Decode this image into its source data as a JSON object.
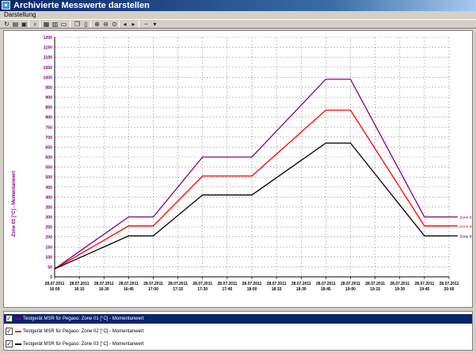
{
  "window": {
    "title": "Archivierte Messwerte darstellen",
    "icon": "app-chart-icon"
  },
  "menu": {
    "items": [
      "Darstellung"
    ]
  },
  "toolbar": {
    "buttons": [
      {
        "name": "refresh-icon",
        "glyph": "↻"
      },
      {
        "name": "print-icon",
        "glyph": "▤"
      },
      {
        "name": "save-icon",
        "glyph": "▣"
      },
      {
        "name": "find-icon",
        "glyph": "⌕"
      },
      {
        "name": "table-icon",
        "glyph": "▦"
      },
      {
        "name": "grid-icon",
        "glyph": "▥"
      },
      {
        "name": "export-icon",
        "glyph": "▭"
      },
      {
        "name": "copy-icon",
        "glyph": "❐"
      },
      {
        "name": "layout-icon",
        "glyph": "▯"
      },
      {
        "name": "zoom-in-icon",
        "glyph": "⊕"
      },
      {
        "name": "zoom-out-icon",
        "glyph": "⊖"
      },
      {
        "name": "zoom-reset-icon",
        "glyph": "⊙"
      },
      {
        "name": "scroll-left-icon",
        "glyph": "◂"
      },
      {
        "name": "scroll-right-icon",
        "glyph": "▸"
      },
      {
        "name": "line-style-icon",
        "glyph": "┄"
      },
      {
        "name": "dropdown-icon",
        "glyph": "▾"
      }
    ]
  },
  "chart_data": {
    "type": "line",
    "title": "",
    "xlabel": "",
    "ylabel": "Zone 01 [°C] - Momentanwert",
    "ylim": [
      0,
      1200
    ],
    "yticks": [
      0,
      50,
      100,
      150,
      200,
      250,
      300,
      350,
      400,
      450,
      500,
      550,
      600,
      650,
      700,
      750,
      800,
      850,
      900,
      950,
      1000,
      1050,
      1100,
      1150,
      1200
    ],
    "grid": true,
    "x_ticks": [
      {
        "date": "28.07.2011",
        "time": "16:00"
      },
      {
        "date": "28.07.2011",
        "time": "16:15"
      },
      {
        "date": "28.07.2011",
        "time": "16:30"
      },
      {
        "date": "28.07.2011",
        "time": "16:45"
      },
      {
        "date": "28.07.2011",
        "time": "17:00"
      },
      {
        "date": "28.07.2011",
        "time": "17:15"
      },
      {
        "date": "28.07.2011",
        "time": "17:30"
      },
      {
        "date": "28.07.2011",
        "time": "17:45"
      },
      {
        "date": "28.07.2011",
        "time": "18:00"
      },
      {
        "date": "28.07.2011",
        "time": "18:15"
      },
      {
        "date": "28.07.2011",
        "time": "18:30"
      },
      {
        "date": "28.07.2011",
        "time": "18:45"
      },
      {
        "date": "28.07.2011",
        "time": "19:00"
      },
      {
        "date": "28.07.2011",
        "time": "19:15"
      },
      {
        "date": "28.07.2011",
        "time": "19:30"
      },
      {
        "date": "28.07.2011",
        "time": "19:45"
      },
      {
        "date": "28.07.2011",
        "time": "20:00"
      }
    ],
    "series": [
      {
        "name": "Zone 01",
        "color": "#800080",
        "points": [
          [
            "28.07.2011 16:00",
            40
          ],
          [
            "28.07.2011 16:45",
            300
          ],
          [
            "28.07.2011 17:00",
            300
          ],
          [
            "28.07.2011 17:30",
            600
          ],
          [
            "28.07.2011 18:00",
            600
          ],
          [
            "28.07.2011 18:45",
            990
          ],
          [
            "28.07.2011 19:00",
            990
          ],
          [
            "28.07.2011 19:45",
            300
          ],
          [
            "28.07.2011 20:05",
            300
          ]
        ]
      },
      {
        "name": "Zone 02",
        "color": "#ff0000",
        "points": [
          [
            "28.07.2011 16:00",
            40
          ],
          [
            "28.07.2011 16:45",
            255
          ],
          [
            "28.07.2011 17:00",
            255
          ],
          [
            "28.07.2011 17:30",
            505
          ],
          [
            "28.07.2011 18:00",
            505
          ],
          [
            "28.07.2011 18:45",
            835
          ],
          [
            "28.07.2011 19:00",
            835
          ],
          [
            "28.07.2011 19:45",
            255
          ],
          [
            "28.07.2011 20:05",
            255
          ]
        ]
      },
      {
        "name": "Zone 03",
        "color": "#000000",
        "points": [
          [
            "28.07.2011 16:00",
            40
          ],
          [
            "28.07.2011 16:45",
            205
          ],
          [
            "28.07.2011 17:00",
            205
          ],
          [
            "28.07.2011 17:30",
            410
          ],
          [
            "28.07.2011 18:00",
            410
          ],
          [
            "28.07.2011 18:45",
            670
          ],
          [
            "28.07.2011 19:00",
            670
          ],
          [
            "28.07.2011 19:45",
            205
          ],
          [
            "28.07.2011 20:05",
            205
          ]
        ]
      }
    ]
  },
  "legend": {
    "items": [
      {
        "label": "Testgerät MSR für Pegaso: Zone 01 [°C] - Momentanwert",
        "color": "#800080",
        "checked": true,
        "selected": true
      },
      {
        "label": "Testgerät MSR für Pegaso: Zone 02 [°C] - Momentanwert",
        "color": "#ff0000",
        "checked": true,
        "selected": false
      },
      {
        "label": "Testgerät MSR für Pegaso: Zone 03 [°C] - Momentanwert",
        "color": "#000000",
        "checked": true,
        "selected": false
      }
    ]
  }
}
